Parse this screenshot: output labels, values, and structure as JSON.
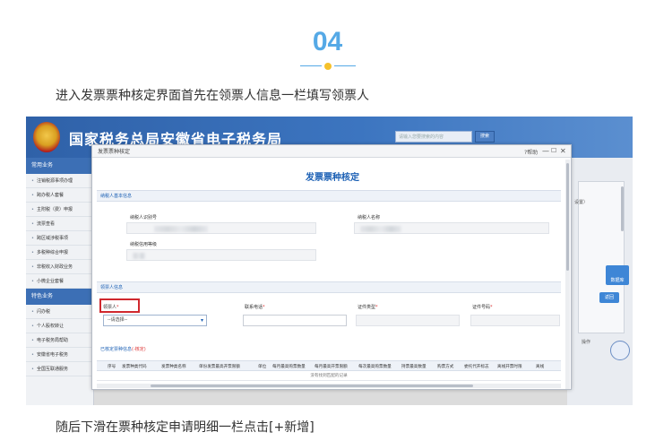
{
  "article": {
    "step_number": "04",
    "intro_text": "进入发票票种核定界面首先在领票人信息一栏填写领票人",
    "footer_text": "随后下滑在票种核定申请明细一栏点击[+新增]"
  },
  "portal": {
    "title": "国家税务总局安徽省电子税务局",
    "search_placeholder": "请输入您要搜索的内容",
    "search_button": "搜索"
  },
  "sidebar": {
    "header1": "常用业务",
    "items1": [
      "注销税源事项办理",
      "跨办税人套餐",
      "主附税（费）申报",
      "流票查看",
      "跨区域涉税事项",
      "多税种综合申报",
      "非税收入财政业务",
      "小微企业套餐"
    ],
    "header2": "特色业务",
    "items2": [
      "闪办税",
      "个人股权转让",
      "电子税务局帮助",
      "安徽省电子税务",
      "全国互联通服务"
    ]
  },
  "right_panel": {
    "edge_text": "设置）",
    "float_button": "数据库",
    "return_button": "返回",
    "op_text": "操作"
  },
  "modal": {
    "window_title": "发票票种核定",
    "help_label": "?帮助",
    "min_icon": "—",
    "max_icon": "☐",
    "close_icon": "✕",
    "form_title": "发票票种核定",
    "basic_section": "纳税人基本信息",
    "taxpayer_id_label": "纳税人识别号",
    "taxpayer_name_label": "纳税人名称",
    "credit_label": "纳税信用等级",
    "picker_section": "领票人信息",
    "picker_label": "领票人",
    "required_mark": "*",
    "picker_placeholder": "--请选择--",
    "phone_label": "联系电话",
    "id_type_label": "证件类型",
    "id_number_label": "证件号码",
    "detail_section": "已核定票种信息",
    "detail_note": "(-核定)",
    "table_headers": [
      "序号",
      "发票种类代码",
      "发票种类名称",
      "单份发票最高开票限额",
      "单位",
      "每月最高购票数量",
      "每月最高开票限额",
      "每次最高购票数量",
      "持票最高数量",
      "购票方式",
      "委托代开标志",
      "离线开票时限",
      "离线"
    ],
    "empty_text": "没有找到匹配的记录"
  }
}
